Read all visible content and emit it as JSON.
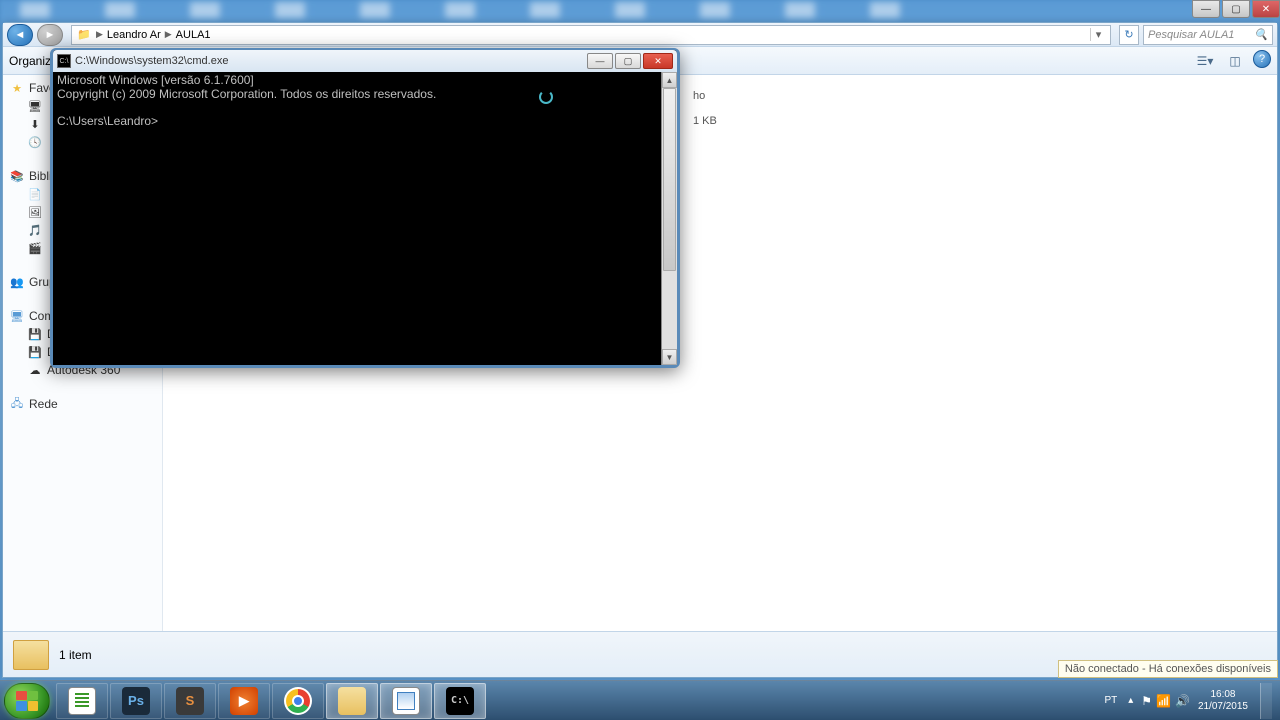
{
  "explorer": {
    "breadcrumb": {
      "part1": "Leandro Ar",
      "part2": "AULA1"
    },
    "search_placeholder": "Pesquisar AULA1",
    "toolbar": {
      "organize": "Organizar"
    },
    "sidebar": {
      "favorites": "Favoritos",
      "libraries": "Bibliotecas",
      "group": "Grupo",
      "computer": "Computador",
      "disk_c": "Disco Local (C:)",
      "disk_e": "Disco Local (E:)",
      "autodesk": "Autodesk 360",
      "network": "Rede"
    },
    "content": {
      "file_ext": "ho",
      "file_size": "1 KB"
    },
    "status": {
      "item_count": "1 item"
    }
  },
  "cmd": {
    "title": "C:\\Windows\\system32\\cmd.exe",
    "line1": "Microsoft Windows [versão 6.1.7600]",
    "line2": "Copyright (c) 2009 Microsoft Corporation. Todos os direitos reservados.",
    "prompt": "C:\\Users\\Leandro>"
  },
  "network_tooltip": "Não conectado - Há conexões disponíveis",
  "taskbar": {
    "lang": "PT",
    "time": "16:08",
    "date": "21/07/2015"
  }
}
